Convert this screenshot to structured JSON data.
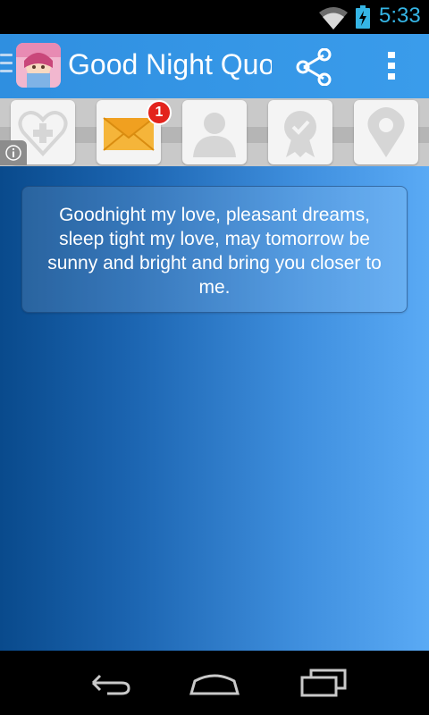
{
  "status_bar": {
    "time": "5:33",
    "icons": [
      "wifi-icon",
      "battery-charging-icon"
    ],
    "accent_color": "#35b5e5"
  },
  "action_bar": {
    "title": "Good Night Quotes",
    "icons": [
      "drawer-icon",
      "app-icon",
      "share-icon",
      "overflow-menu-icon"
    ],
    "background_color": "#3a9ceb"
  },
  "ad_strip": {
    "tiles": [
      "heart-plus-icon",
      "mail-icon",
      "person-icon",
      "award-badge-icon",
      "location-pin-icon"
    ],
    "notification_count": "1",
    "info_icon": "info-icon"
  },
  "quote": {
    "text": "Goodnight my love, pleasant dreams, sleep tight my love, may tomorrow be sunny and bright and bring you closer to me."
  },
  "nav_bar": {
    "buttons": [
      "back-icon",
      "home-icon",
      "recents-icon"
    ]
  }
}
